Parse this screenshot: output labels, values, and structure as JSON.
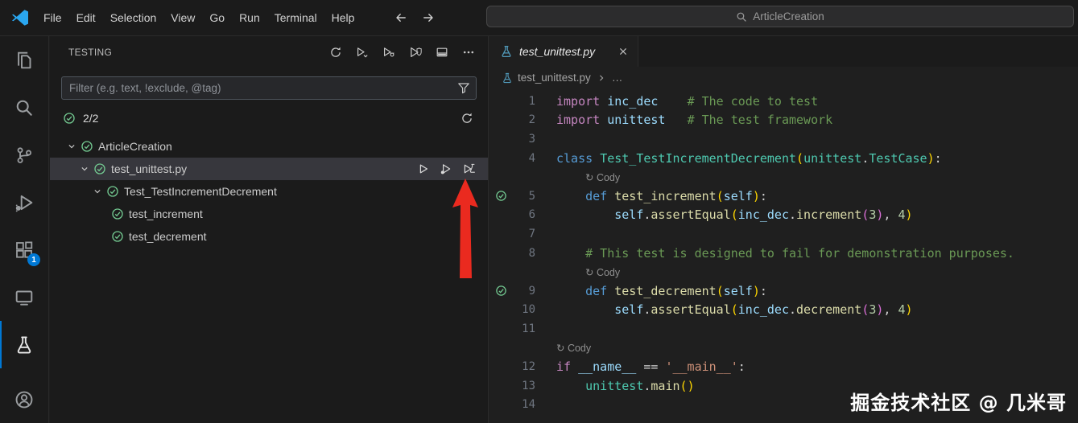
{
  "title_bar": {
    "menus": [
      "File",
      "Edit",
      "Selection",
      "View",
      "Go",
      "Run",
      "Terminal",
      "Help"
    ],
    "search_text": "ArticleCreation"
  },
  "activity_bar": {
    "items": [
      {
        "icon": "explorer",
        "name": "explorer"
      },
      {
        "icon": "search",
        "name": "search"
      },
      {
        "icon": "source-control",
        "name": "source-control"
      },
      {
        "icon": "run-debug",
        "name": "run-and-debug"
      },
      {
        "icon": "extensions",
        "name": "extensions",
        "badge": "1"
      },
      {
        "icon": "remote-explorer",
        "name": "remote-explorer"
      },
      {
        "icon": "testing",
        "name": "testing",
        "active": true
      }
    ],
    "bottom_items": [
      {
        "icon": "account",
        "name": "account"
      }
    ]
  },
  "sidebar": {
    "title": "TESTING",
    "toolbar": [
      {
        "icon": "refresh",
        "name": "refresh-tests"
      },
      {
        "icon": "run-all",
        "name": "run-tests"
      },
      {
        "icon": "debug-all",
        "name": "debug-tests"
      },
      {
        "icon": "run-coverage",
        "name": "run-tests-with-coverage"
      },
      {
        "icon": "open-panel",
        "name": "show-output"
      },
      {
        "icon": "more",
        "name": "more-actions"
      }
    ],
    "filter_placeholder": "Filter (e.g. text, !exclude, @tag)",
    "results": {
      "state": "pass",
      "count": "2/2"
    },
    "tree": [
      {
        "label": "ArticleCreation",
        "indent": 0,
        "expanded": true,
        "state": "pass"
      },
      {
        "label": "test_unittest.py",
        "indent": 1,
        "expanded": true,
        "state": "pass",
        "selected": true,
        "actions": [
          {
            "icon": "play",
            "name": "run-test"
          },
          {
            "icon": "debug-alt",
            "name": "debug-test"
          },
          {
            "icon": "coverage",
            "name": "run-with-coverage"
          }
        ]
      },
      {
        "label": "Test_TestIncrementDecrement",
        "indent": 2,
        "expanded": true,
        "state": "pass"
      },
      {
        "label": "test_increment",
        "indent": 3,
        "state": "pass"
      },
      {
        "label": "test_decrement",
        "indent": 3,
        "state": "pass"
      }
    ]
  },
  "editor": {
    "tab": {
      "label": "test_unittest.py",
      "icon": "beaker"
    },
    "breadcrumb": {
      "icon": "beaker",
      "file": "test_unittest.py",
      "more": "…"
    },
    "lines": [
      {
        "num": "1",
        "tokens": [
          [
            "import",
            "kw"
          ],
          [
            " ",
            "pl"
          ],
          [
            "inc_dec",
            "var"
          ],
          [
            "    ",
            "pl"
          ],
          [
            "# The code to test",
            "com"
          ]
        ]
      },
      {
        "num": "2",
        "tokens": [
          [
            "import",
            "kw"
          ],
          [
            " ",
            "pl"
          ],
          [
            "unittest",
            "var"
          ],
          [
            "   ",
            "pl"
          ],
          [
            "# The test framework",
            "com"
          ]
        ]
      },
      {
        "num": "3",
        "tokens": []
      },
      {
        "num": "4",
        "tokens": [
          [
            "class",
            "kwb"
          ],
          [
            " ",
            "pl"
          ],
          [
            "Test_TestIncrementDecrement",
            "cls"
          ],
          [
            "(",
            "p1"
          ],
          [
            "unittest",
            "cls"
          ],
          [
            ".",
            "pl"
          ],
          [
            "TestCase",
            "cls"
          ],
          [
            ")",
            "p1"
          ],
          [
            ":",
            "pl"
          ]
        ]
      },
      {
        "lens": "Cody",
        "icon": "↻",
        "indent": 4
      },
      {
        "num": "5",
        "pass": true,
        "tokens": [
          [
            "    ",
            "pl"
          ],
          [
            "def",
            "kwb"
          ],
          [
            " ",
            "pl"
          ],
          [
            "test_increment",
            "fn"
          ],
          [
            "(",
            "p1"
          ],
          [
            "self",
            "slf"
          ],
          [
            ")",
            "p1"
          ],
          [
            ":",
            "pl"
          ]
        ]
      },
      {
        "num": "6",
        "tokens": [
          [
            "        ",
            "pl"
          ],
          [
            "self",
            "slf"
          ],
          [
            ".",
            "pl"
          ],
          [
            "assertEqual",
            "fn"
          ],
          [
            "(",
            "p1"
          ],
          [
            "inc_dec",
            "var"
          ],
          [
            ".",
            "pl"
          ],
          [
            "increment",
            "fn"
          ],
          [
            "(",
            "p2"
          ],
          [
            "3",
            "num"
          ],
          [
            ")",
            "p2"
          ],
          [
            ", ",
            "pl"
          ],
          [
            "4",
            "num"
          ],
          [
            ")",
            "p1"
          ]
        ]
      },
      {
        "num": "7",
        "tokens": []
      },
      {
        "num": "8",
        "tokens": [
          [
            "    ",
            "pl"
          ],
          [
            "# This test is designed to fail for demonstration purposes.",
            "com"
          ]
        ]
      },
      {
        "lens": "Cody",
        "icon": "↻",
        "indent": 4
      },
      {
        "num": "9",
        "pass": true,
        "tokens": [
          [
            "    ",
            "pl"
          ],
          [
            "def",
            "kwb"
          ],
          [
            " ",
            "pl"
          ],
          [
            "test_decrement",
            "fn"
          ],
          [
            "(",
            "p1"
          ],
          [
            "self",
            "slf"
          ],
          [
            ")",
            "p1"
          ],
          [
            ":",
            "pl"
          ]
        ]
      },
      {
        "num": "10",
        "tokens": [
          [
            "        ",
            "pl"
          ],
          [
            "self",
            "slf"
          ],
          [
            ".",
            "pl"
          ],
          [
            "assertEqual",
            "fn"
          ],
          [
            "(",
            "p1"
          ],
          [
            "inc_dec",
            "var"
          ],
          [
            ".",
            "pl"
          ],
          [
            "decrement",
            "fn"
          ],
          [
            "(",
            "p2"
          ],
          [
            "3",
            "num"
          ],
          [
            ")",
            "p2"
          ],
          [
            ", ",
            "pl"
          ],
          [
            "4",
            "num"
          ],
          [
            ")",
            "p1"
          ]
        ]
      },
      {
        "num": "11",
        "tokens": []
      },
      {
        "lens": "Cody",
        "icon": "↻",
        "indent": 0
      },
      {
        "num": "12",
        "tokens": [
          [
            "if",
            "kw"
          ],
          [
            " ",
            "pl"
          ],
          [
            "__name__",
            "var"
          ],
          [
            " ",
            "pl"
          ],
          [
            "==",
            "pl"
          ],
          [
            " ",
            "pl"
          ],
          [
            "'__main__'",
            "str"
          ],
          [
            ":",
            "pl"
          ]
        ]
      },
      {
        "num": "13",
        "tokens": [
          [
            "    ",
            "pl"
          ],
          [
            "unittest",
            "cls"
          ],
          [
            ".",
            "pl"
          ],
          [
            "main",
            "fn"
          ],
          [
            "(",
            "p1"
          ],
          [
            ")",
            "p1"
          ]
        ]
      },
      {
        "num": "14",
        "tokens": []
      }
    ]
  },
  "annotation": {
    "watermark": "掘金技术社区 @ 几米哥"
  },
  "colors": {
    "accent": "#0078d4",
    "pass_green": "#73c991",
    "arrow_red": "#ea2a1f",
    "badge_blue": "#0078d4",
    "file_icon_blue": "#519aba"
  }
}
